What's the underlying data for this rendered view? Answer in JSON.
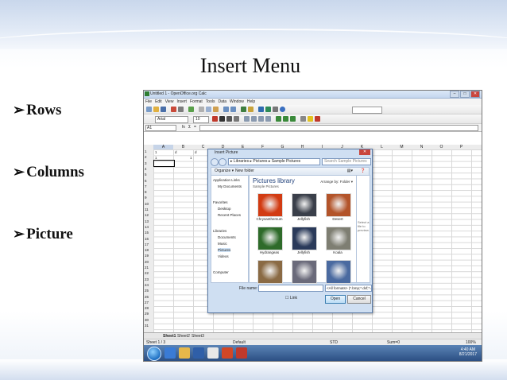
{
  "slide": {
    "title": "Insert Menu",
    "bullets": [
      "Rows",
      "Columns",
      "Picture"
    ]
  },
  "calc": {
    "window_title": "Untitled 1 - OpenOffice.org Calc",
    "menu": [
      "File",
      "Edit",
      "View",
      "Insert",
      "Format",
      "Tools",
      "Data",
      "Window",
      "Help"
    ],
    "font_name": "Arial",
    "font_size": "10",
    "name_box": "A1",
    "fx": "fx",
    "sum": "Σ",
    "eq": "=",
    "columns": [
      "A",
      "B",
      "C",
      "D",
      "E",
      "F",
      "G",
      "H",
      "I",
      "J",
      "K",
      "L",
      "M",
      "N",
      "O",
      "P"
    ],
    "rows": [
      "1",
      "2",
      "3",
      "4",
      "5",
      "6",
      "7",
      "8",
      "9",
      "10",
      "11",
      "12",
      "13",
      "14",
      "15",
      "16",
      "17",
      "18",
      "19",
      "20",
      "21",
      "22",
      "23",
      "24",
      "25",
      "26",
      "27",
      "28",
      "29",
      "30",
      "31"
    ],
    "row1": [
      "1",
      "d",
      "d",
      "d"
    ],
    "row2": [
      "1",
      "1"
    ],
    "sheet_tabs": [
      "Sheet1",
      "Sheet2",
      "Sheet3"
    ],
    "status": {
      "sheet": "Sheet 1 / 3",
      "style": "Default",
      "mode": "STD",
      "sum": "Sum=0",
      "zoom": "100%"
    },
    "clock": {
      "time": "4:40 AM",
      "date": "8/21/2017"
    }
  },
  "dialog": {
    "title": "Insert Picture",
    "breadcrumb": "▸ Libraries ▸ Pictures ▸ Sample Pictures",
    "search_placeholder": "Search Sample Pictures",
    "organize": "Organize ▾",
    "new_folder": "New folder",
    "nav": [
      {
        "label": "Application Links",
        "kind": "hdr"
      },
      {
        "label": "My Documents",
        "kind": "sub"
      },
      {
        "label": "Favorites",
        "kind": "hdr"
      },
      {
        "label": "Desktop",
        "kind": "sub"
      },
      {
        "label": "Recent Places",
        "kind": "sub"
      },
      {
        "label": "Libraries",
        "kind": "hdr"
      },
      {
        "label": "Documents",
        "kind": "sub"
      },
      {
        "label": "Music",
        "kind": "sub"
      },
      {
        "label": "Pictures",
        "kind": "sub"
      },
      {
        "label": "Videos",
        "kind": "sub"
      },
      {
        "label": "Computer",
        "kind": "hdr"
      }
    ],
    "library_title": "Pictures library",
    "library_sub": "Sample Pictures",
    "arrange_by": "Arrange by:  Folder ▾",
    "thumbs": [
      {
        "label": "Chrysanthemum",
        "color": "#d23b12"
      },
      {
        "label": "Jellyfish",
        "color": "#3a3f4a"
      },
      {
        "label": "Desert",
        "color": "#b3542a"
      },
      {
        "label": "Hydrangeas",
        "color": "#2e6b2a"
      },
      {
        "label": "Jellyfish",
        "color": "#2a3a5a"
      },
      {
        "label": "Koala",
        "color": "#7e7e72"
      },
      {
        "label": "",
        "color": "#8a6a44"
      },
      {
        "label": "",
        "color": "#6a6a7a"
      },
      {
        "label": "",
        "color": "#4a6aa0"
      }
    ],
    "preview_text": "Select a file to preview.",
    "file_name_label": "File name:",
    "filter": "<All formats> (*.bmp;*.dxf;*.em",
    "link_label": "Link",
    "open_label": "Open",
    "cancel_label": "Cancel"
  }
}
